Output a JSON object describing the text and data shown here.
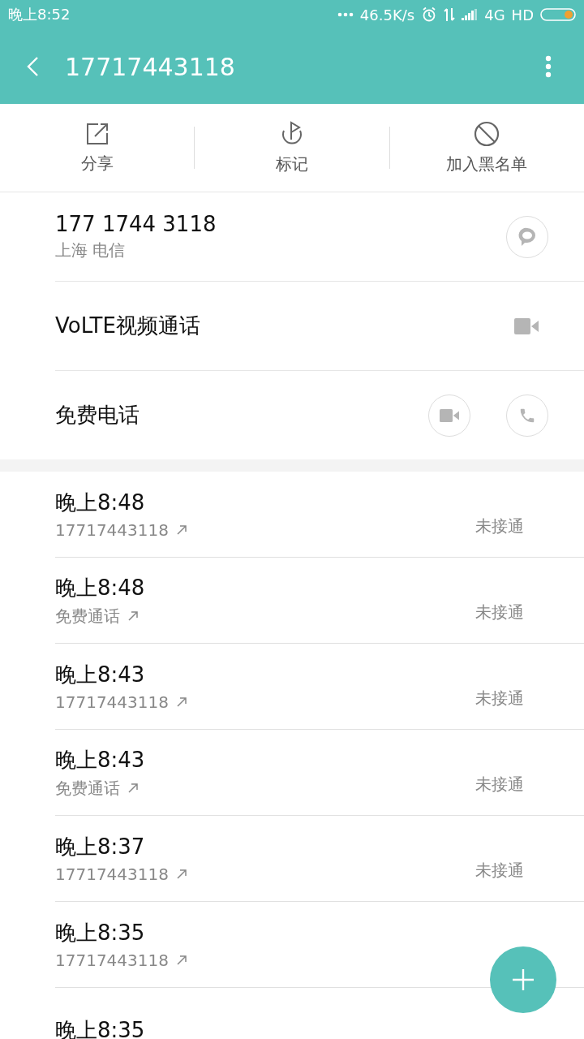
{
  "status_bar": {
    "time": "晚上8:52",
    "speed": "46.5K/s",
    "network": "4G",
    "hd": "HD"
  },
  "toolbar": {
    "title": "17717443118"
  },
  "actions": [
    {
      "kind": "share",
      "label": "分享"
    },
    {
      "kind": "mark",
      "label": "标记"
    },
    {
      "kind": "block",
      "label": "加入黑名单"
    }
  ],
  "contact": {
    "number": "177 1744 3118",
    "location": "上海 电信"
  },
  "video_call": {
    "label": "VoLTE视频通话"
  },
  "free_call": {
    "label": "免费电话"
  },
  "calls": [
    {
      "time": "晚上8:48",
      "detail": "17717443118",
      "status": "未接通"
    },
    {
      "time": "晚上8:48",
      "detail": "免费通话",
      "status": "未接通"
    },
    {
      "time": "晚上8:43",
      "detail": "17717443118",
      "status": "未接通"
    },
    {
      "time": "晚上8:43",
      "detail": "免费通话",
      "status": "未接通"
    },
    {
      "time": "晚上8:37",
      "detail": "17717443118",
      "status": "未接通"
    },
    {
      "time": "晚上8:35",
      "detail": "17717443118"
    },
    {
      "time": "晚上8:35"
    }
  ]
}
